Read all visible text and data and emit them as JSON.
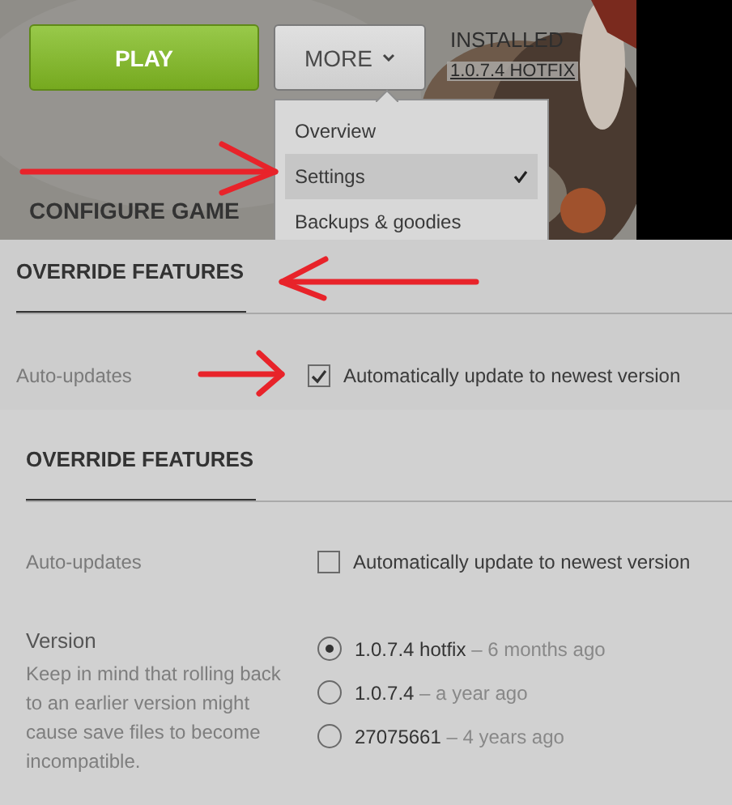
{
  "top": {
    "play_button": "PLAY",
    "more_button": "MORE",
    "installed_label": "INSTALLED",
    "installed_version": "1.0.7.4 HOTFIX",
    "menu": [
      {
        "label": "Overview",
        "selected": false
      },
      {
        "label": "Settings",
        "selected": true
      },
      {
        "label": "Backups & goodies",
        "selected": false
      }
    ],
    "section_title": "CONFIGURE GAME"
  },
  "panels": [
    {
      "heading": "OVERRIDE FEATURES",
      "auto_updates": {
        "label": "Auto-updates",
        "option": "Automatically update to newest version",
        "checked": true
      }
    },
    {
      "heading": "OVERRIDE FEATURES",
      "auto_updates": {
        "label": "Auto-updates",
        "option": "Automatically update to newest version",
        "checked": false
      },
      "version": {
        "label": "Version",
        "note": "Keep in mind that rolling back to an earlier version might cause save files to become incompatible.",
        "options": [
          {
            "name": "1.0.7.4 hotfix",
            "age": "– 6 months ago",
            "selected": true
          },
          {
            "name": "1.0.7.4",
            "age": "– a year ago",
            "selected": false
          },
          {
            "name": "27075661",
            "age": "– 4 years ago",
            "selected": false
          }
        ]
      }
    }
  ]
}
